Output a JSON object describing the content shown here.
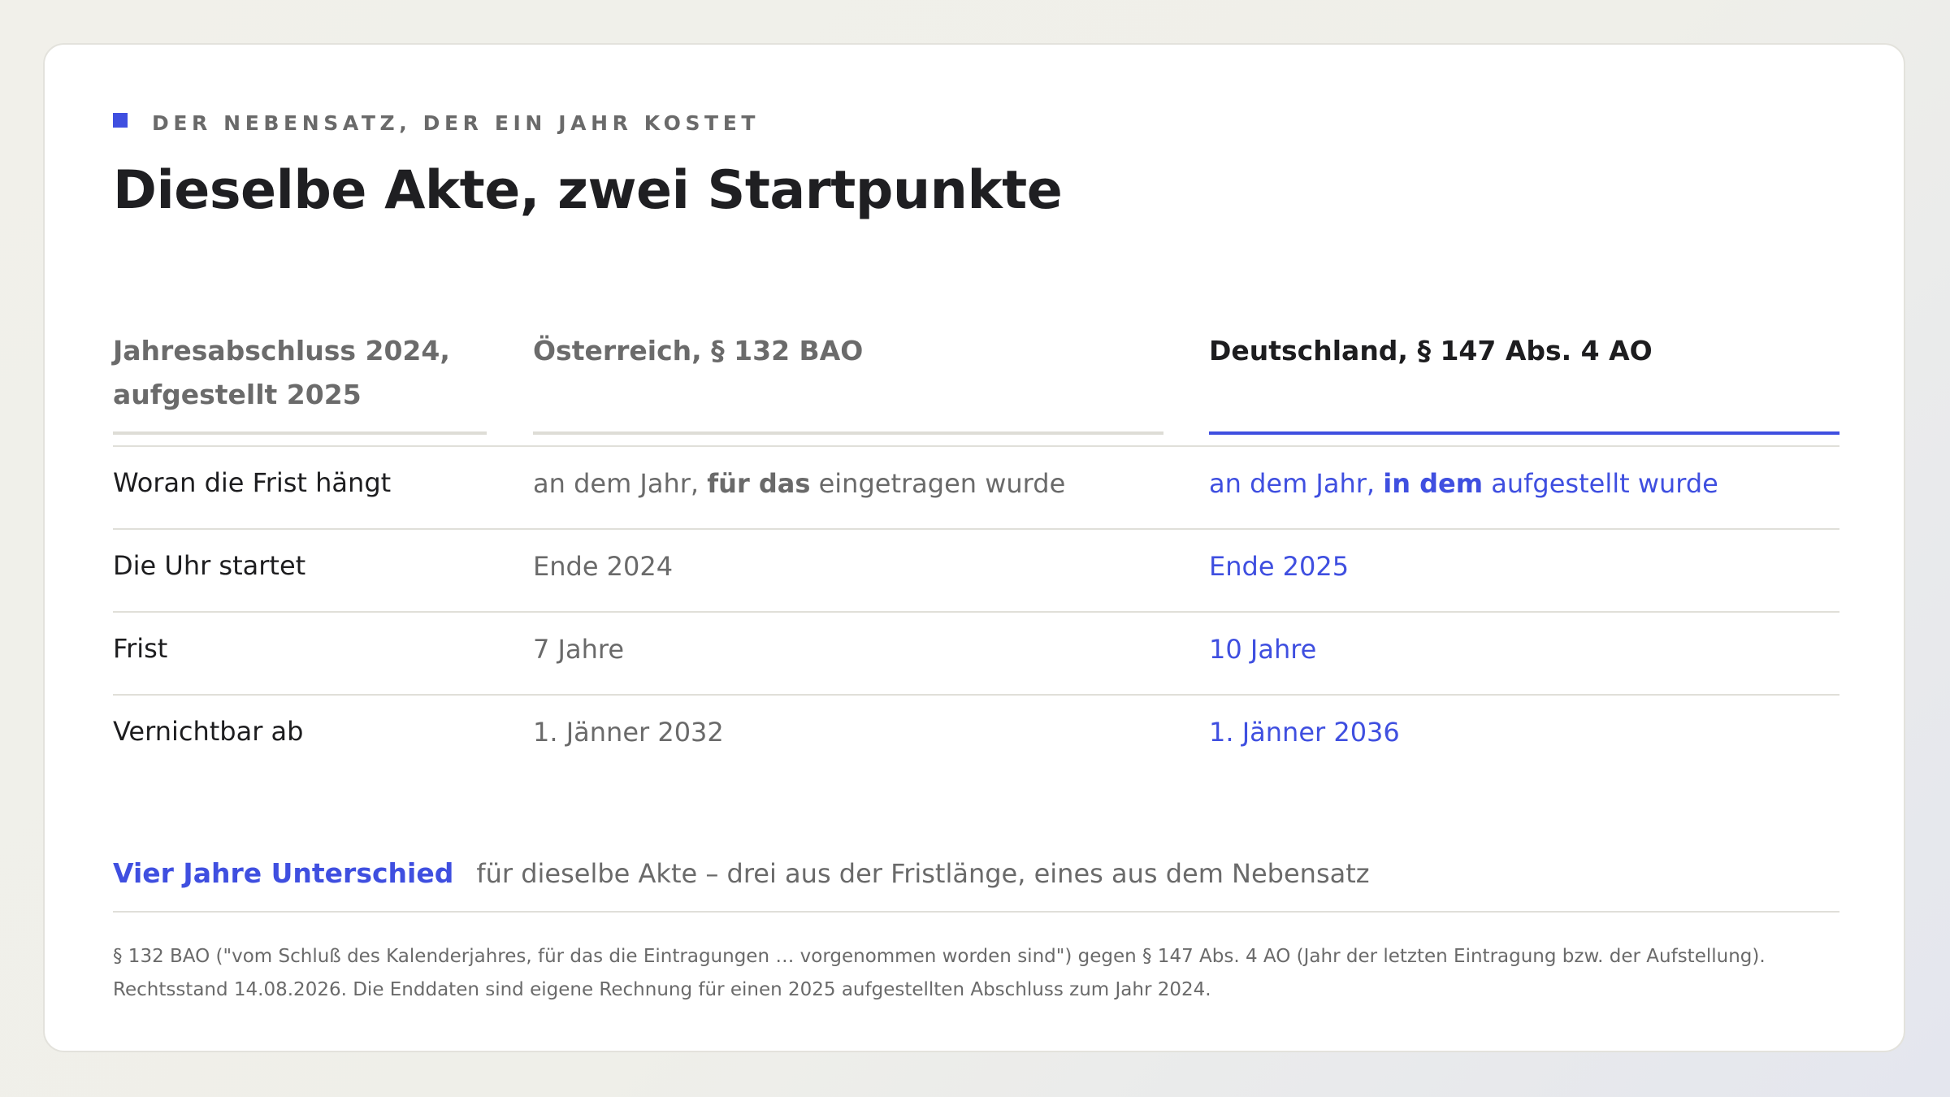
{
  "header": {
    "kicker": "DER NEBENSATZ, DER EIN JAHR KOSTET",
    "title": "Dieselbe Akte, zwei Startpunkte"
  },
  "table": {
    "columns": {
      "case": [
        "Jahresabschluss 2024,",
        "aufgestellt 2025"
      ],
      "austria": "Österreich, § 132 BAO",
      "germany": "Deutschland, § 147 Abs. 4 AO"
    },
    "rows": [
      {
        "label": "Woran die Frist hängt",
        "austria": {
          "pre": "an dem Jahr, ",
          "bold": "für das",
          "post": " eingetragen wurde"
        },
        "germany": {
          "pre": "an dem Jahr, ",
          "bold": "in dem",
          "post": " aufgestellt wurde"
        }
      },
      {
        "label": "Die Uhr startet",
        "austria": "Ende 2024",
        "germany": "Ende 2025"
      },
      {
        "label": "Frist",
        "austria": "7 Jahre",
        "germany": "10 Jahre"
      },
      {
        "label": "Vernichtbar ab",
        "austria": "1. Jänner 2032",
        "germany": "1. Jänner 2036"
      }
    ]
  },
  "summary": {
    "highlight": "Vier Jahre Unterschied",
    "text": "für dieselbe Akte – drei aus der Fristlänge, eines aus dem Nebensatz"
  },
  "footnote": {
    "line1": "§ 132 BAO (\"vom Schluß des Kalenderjahres, für das die Eintragungen … vorgenommen worden sind\") gegen § 147 Abs. 4 AO (Jahr der letzten Eintragung bzw. der Aufstellung).",
    "line2": "Rechtsstand 14.08.2026. Die Enddaten sind eigene Rechnung für einen 2025 aufgestellten Abschluss zum Jahr 2024."
  },
  "colors": {
    "accent": "#3f4fe0",
    "text": "#1d1d1f",
    "muted": "#6a6a6a",
    "rule": "#e0dfd9"
  }
}
